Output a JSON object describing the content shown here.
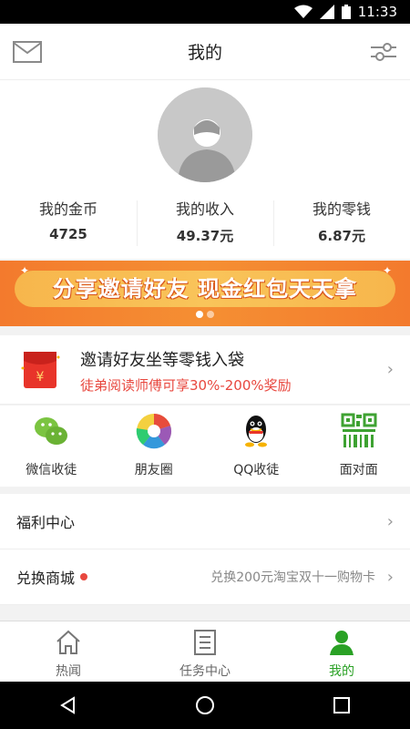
{
  "status_bar": {
    "time": "11:33",
    "icons": [
      "wifi-icon",
      "signal-icon",
      "battery-icon"
    ]
  },
  "header": {
    "title": "我的",
    "left_icon": "mail-icon",
    "right_icon": "filter-settings-icon"
  },
  "profile": {
    "avatar_icon": "default-avatar-icon",
    "stats": [
      {
        "label": "我的金币",
        "value": "4725"
      },
      {
        "label": "我的收入",
        "value": "49.37元"
      },
      {
        "label": "我的零钱",
        "value": "6.87元"
      }
    ]
  },
  "banner": {
    "text": "分享邀请好友  现金红包天天拿",
    "page_count": 2,
    "active_page": 1
  },
  "invite": {
    "title": "邀请好友坐等零钱入袋",
    "subtitle": "徒弟阅读师傅可享30%-200%奖励",
    "icon": "red-packet-icon"
  },
  "share": [
    {
      "label": "微信收徒",
      "icon": "wechat-icon"
    },
    {
      "label": "朋友圈",
      "icon": "moments-icon"
    },
    {
      "label": "QQ收徒",
      "icon": "qq-icon"
    },
    {
      "label": "面对面",
      "icon": "qrcode-icon"
    }
  ],
  "list": [
    {
      "label": "福利中心",
      "right_text": ""
    },
    {
      "label": "兑换商城",
      "right_text": "兑换200元淘宝双十一购物卡",
      "badge": true
    }
  ],
  "tabs": [
    {
      "label": "热闻",
      "icon": "home-icon",
      "active": false
    },
    {
      "label": "任务中心",
      "icon": "task-list-icon",
      "active": false
    },
    {
      "label": "我的",
      "icon": "profile-icon",
      "active": true
    }
  ],
  "colors": {
    "accent_green": "#2aa125",
    "red": "#e8483f",
    "banner_orange": "#f37a2d"
  }
}
